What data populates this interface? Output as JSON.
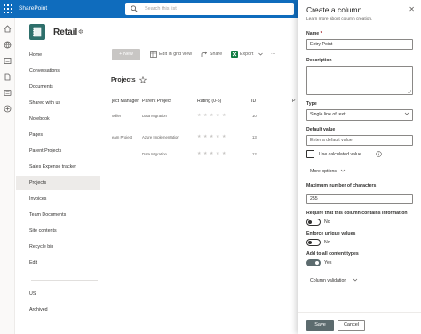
{
  "topbar": {
    "app_name": "SharePoint",
    "search_placeholder": "Search this list"
  },
  "site": {
    "title": "Retail"
  },
  "leftnav": {
    "items": [
      {
        "label": "Home"
      },
      {
        "label": "Conversations"
      },
      {
        "label": "Documents"
      },
      {
        "label": "Shared with us"
      },
      {
        "label": "Notebook"
      },
      {
        "label": "Pages"
      },
      {
        "label": "Parent Projects"
      },
      {
        "label": "Sales Expense tracker"
      },
      {
        "label": "Projects",
        "active": true
      },
      {
        "label": "Invoices"
      },
      {
        "label": "Team Documents"
      },
      {
        "label": "Site contents"
      },
      {
        "label": "Recycle bin"
      },
      {
        "label": "Edit"
      },
      {
        "label": "US"
      },
      {
        "label": "Archived"
      }
    ]
  },
  "commandbar": {
    "new_label": "New",
    "grid_label": "Edit in grid view",
    "share_label": "Share",
    "export_label": "Export",
    "more_label": "···"
  },
  "list": {
    "title": "Projects",
    "columns": [
      "ject Manager",
      "Parent Project",
      "Rating (0-5)",
      "ID",
      "P"
    ],
    "rows": [
      {
        "manager": "Miller",
        "parent": "Data Migration",
        "id": "10"
      },
      {
        "manager": "eam Project",
        "parent": "Azure Implementation",
        "id": "13"
      },
      {
        "manager": "",
        "parent": "Data Migration",
        "id": "12"
      }
    ]
  },
  "panel": {
    "title": "Create a column",
    "subtitle": "Learn more about column creation.",
    "name_label": "Name",
    "name_required": "*",
    "name_value": "Entry Point",
    "description_label": "Description",
    "type_label": "Type",
    "type_value": "Single line of text",
    "default_label": "Default value",
    "default_placeholder": "Enter a default value",
    "calc_label": "Use calculated value",
    "more_options": "More options",
    "max_chars_label": "Maximum number of characters",
    "max_chars_value": "255",
    "require_label": "Require that this column contains information",
    "require_state": "No",
    "unique_label": "Enforce unique values",
    "unique_state": "No",
    "addall_label": "Add to all content types",
    "addall_state": "Yes",
    "validation_label": "Column validation",
    "save_label": "Save",
    "cancel_label": "Cancel"
  },
  "colors": {
    "brand": "#0f6cbd",
    "accent": "#5c6b6e"
  }
}
